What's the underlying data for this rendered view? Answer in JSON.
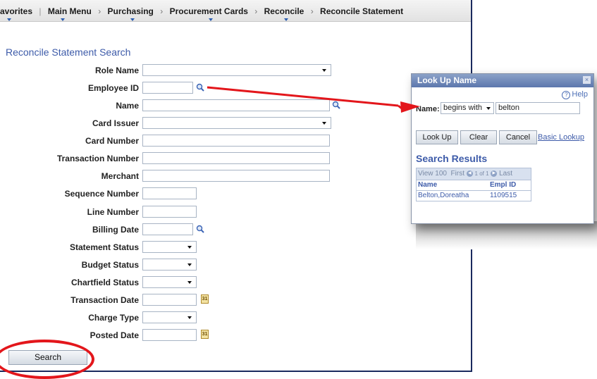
{
  "breadcrumbs": [
    "avorites",
    "Main Menu",
    "Purchasing",
    "Procurement Cards",
    "Reconcile",
    "Reconcile Statement"
  ],
  "page_title": "Reconcile Statement Search",
  "fields": {
    "role_name": "Role Name",
    "employee_id": "Employee ID",
    "name": "Name",
    "card_issuer": "Card Issuer",
    "card_number": "Card Number",
    "transaction_number": "Transaction Number",
    "merchant": "Merchant",
    "sequence_number": "Sequence Number",
    "line_number": "Line Number",
    "billing_date": "Billing Date",
    "statement_status": "Statement Status",
    "budget_status": "Budget Status",
    "chartfield_status": "Chartfield Status",
    "transaction_date": "Transaction Date",
    "charge_type": "Charge Type",
    "posted_date": "Posted Date"
  },
  "search_button": "Search",
  "calendar_glyph": "31",
  "popup": {
    "title": "Look Up Name",
    "close": "×",
    "help": "Help",
    "help_glyph": "?",
    "name_label": "Name:",
    "operator": "begins with",
    "value": "belton",
    "buttons": {
      "lookup": "Look Up",
      "clear": "Clear",
      "cancel": "Cancel"
    },
    "basic_lookup": "Basic Lookup",
    "results_title": "Search Results",
    "pager": {
      "view": "View 100",
      "first": "First",
      "count": "1 of 1",
      "last": "Last"
    },
    "columns": {
      "name": "Name",
      "emplid": "Empl ID"
    },
    "rows": [
      {
        "name": "Belton,Doreatha",
        "emplid": "1109515"
      }
    ]
  },
  "colors": {
    "accent": "#3d5ba9",
    "annotation": "#e3161b"
  }
}
